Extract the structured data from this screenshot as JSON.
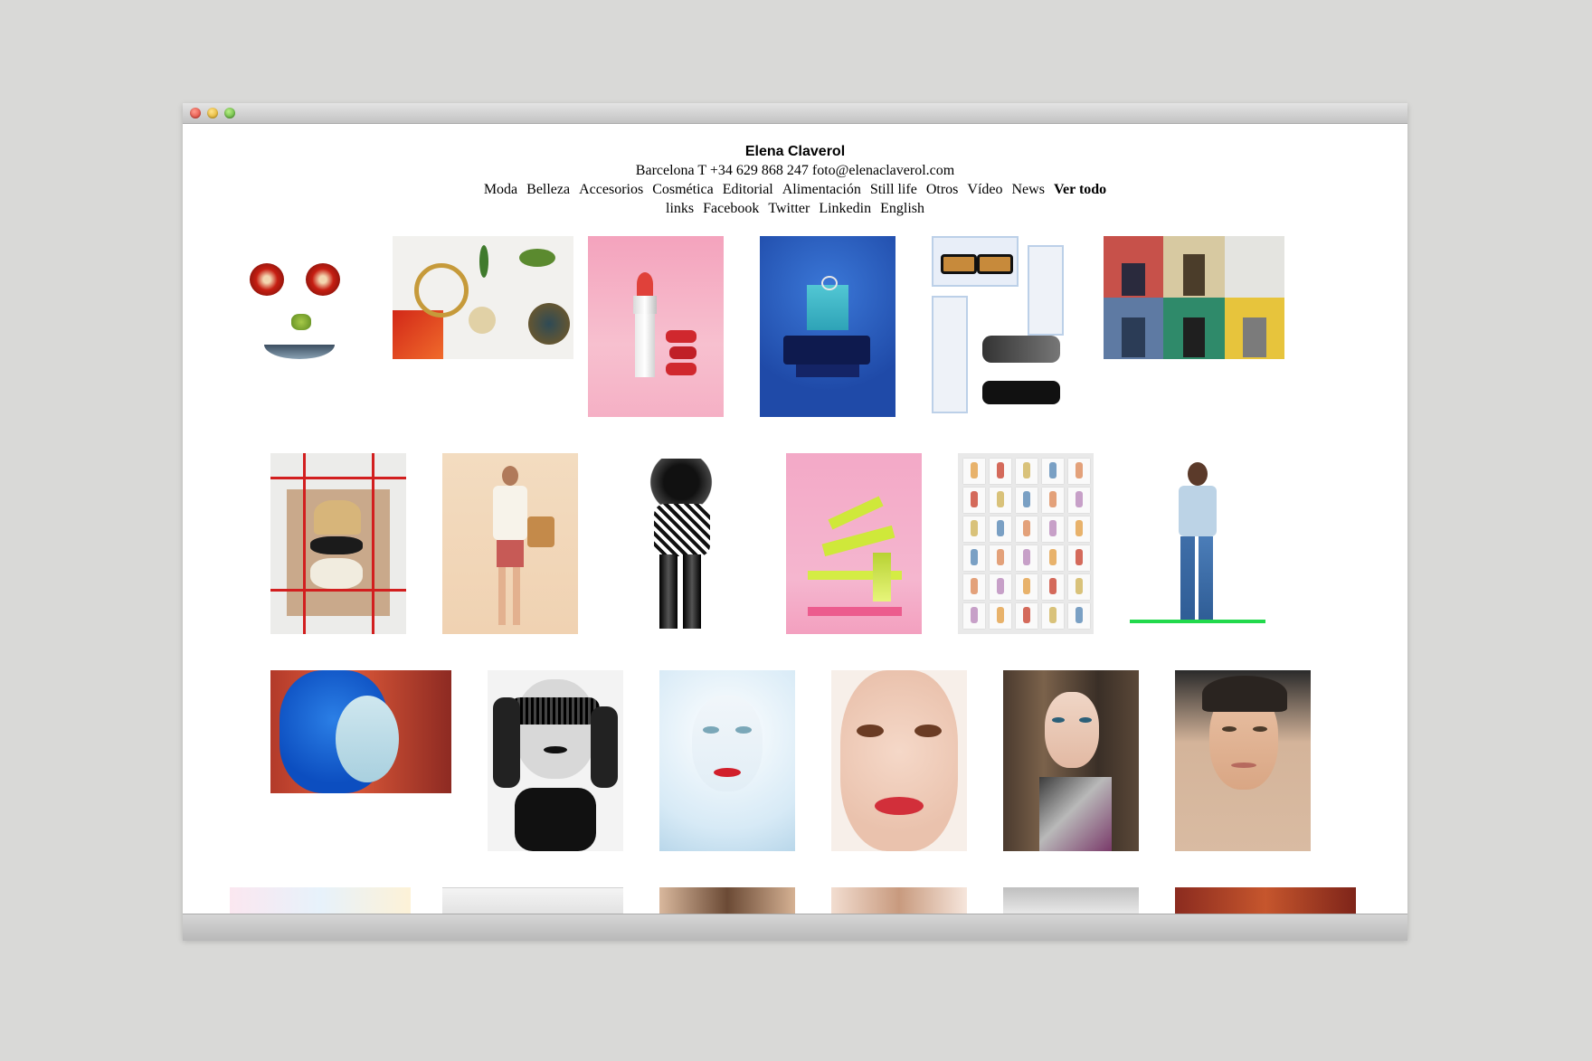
{
  "site": {
    "title": "Elena Claverol",
    "contact": "Barcelona T +34 629 868 247 foto@elenaclaverol.com"
  },
  "nav": {
    "primary": [
      {
        "label": "Moda"
      },
      {
        "label": "Belleza"
      },
      {
        "label": "Accesorios"
      },
      {
        "label": "Cosmética"
      },
      {
        "label": "Editorial"
      },
      {
        "label": "Alimentación"
      },
      {
        "label": "Still life"
      },
      {
        "label": "Otros"
      },
      {
        "label": "Vídeo"
      },
      {
        "label": "News"
      },
      {
        "label": "Ver todo",
        "active": true
      }
    ],
    "secondary": [
      {
        "label": "links"
      },
      {
        "label": "Facebook"
      },
      {
        "label": "Twitter"
      },
      {
        "label": "Linkedin"
      },
      {
        "label": "English"
      }
    ]
  },
  "gallery": {
    "rows": [
      [
        "food-face-photo",
        "jewelry-flatlay-photo",
        "lipstick-photo",
        "ring-blue-photo",
        "sunglasses-photo",
        "menswear-grid-photo"
      ],
      [
        "hats-photo",
        "fashion-model-bag-photo",
        "bw-fashion-photo",
        "yellow-heel-photo",
        "polaroid-wall-photo",
        "denim-model-photo"
      ],
      [
        "blue-wig-portrait-photo",
        "lace-mask-portrait-photo",
        "ice-beauty-portrait-photo",
        "closeup-smile-portrait-photo",
        "long-hair-portrait-photo",
        "studio-portrait-photo"
      ],
      [
        "partial-photo-1",
        "partial-photo-2",
        "partial-photo-3",
        "partial-photo-4",
        "partial-photo-5",
        "partial-photo-6"
      ]
    ]
  },
  "window": {
    "traffic_lights": [
      "close-button",
      "minimize-button",
      "zoom-button"
    ]
  }
}
